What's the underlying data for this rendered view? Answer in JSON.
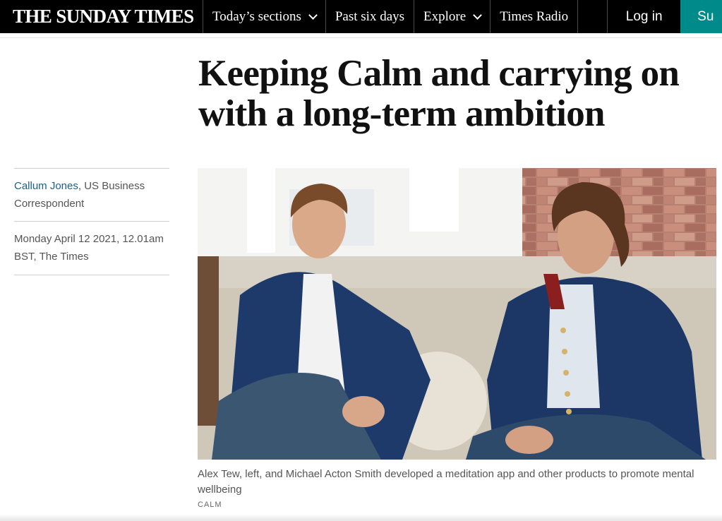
{
  "nav": {
    "logo": "THE SUNDAY TIMES",
    "items": [
      {
        "label": "Today’s sections",
        "icon": "chevron-down-icon"
      },
      {
        "label": "Past six days"
      },
      {
        "label": "Explore",
        "icon": "chevron-down-icon"
      },
      {
        "label": "Times Radio"
      }
    ],
    "login": "Log in",
    "subscribe": "Su",
    "subscribe_color": "#008b8b"
  },
  "article": {
    "headline": "Keeping Calm and carrying on with a long-term ambition",
    "author": "Callum Jones",
    "author_role": ", US Business Correspondent",
    "dateline": "Monday April 12 2021, 12.01am BST, The Times",
    "image_caption": "Alex Tew, left, and Michael Acton Smith developed a meditation app and other products to promote mental wellbeing",
    "image_credit": "CALM",
    "link_color": "#1a5f8b"
  }
}
